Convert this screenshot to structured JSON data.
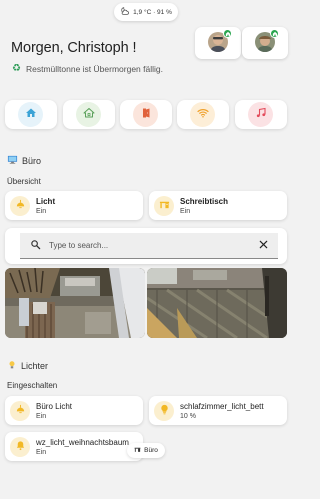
{
  "header": {
    "weather_text": "1,9 °C · 91 %",
    "weather_icon": "partly-cloudy-night-icon",
    "greeting": "Morgen, Christoph !",
    "notice": "Restmülltonne ist Übermorgen fällig.",
    "notice_icon": "recycle-icon"
  },
  "persons": [
    {
      "icon": "avatar",
      "status": "home"
    },
    {
      "icon": "avatar",
      "status": "home"
    }
  ],
  "nav": [
    {
      "icon": "home-icon",
      "color": "#3ba3d6",
      "bg": "#e6f3fa"
    },
    {
      "icon": "house-outline-icon",
      "color": "#5aa05a",
      "bg": "#e8f3e4"
    },
    {
      "icon": "door-icon",
      "color": "#e0623c",
      "bg": "#fbe5dc"
    },
    {
      "icon": "wifi-icon",
      "color": "#f0a12c",
      "bg": "#fdeed7"
    },
    {
      "icon": "music-icon",
      "color": "#e34a5a",
      "bg": "#fbe2e4"
    }
  ],
  "colors": {
    "accent_yellow": "#f2b824",
    "tile_icon_bg": "#fbefcf"
  },
  "buero": {
    "title": "Büro",
    "overview_title": "Übersicht",
    "tiles": [
      {
        "name": "Licht",
        "state": "Ein",
        "icon": "ceiling-light-icon"
      },
      {
        "name": "Schreibtisch",
        "state": "Ein",
        "icon": "desk-icon"
      }
    ],
    "search": {
      "placeholder": "Type to search...",
      "value": ""
    }
  },
  "lights": {
    "title": "Lichter",
    "subtitle": "Eingeschalten",
    "tiles": [
      {
        "name": "Büro Licht",
        "state": "Ein",
        "icon": "ceiling-light-icon"
      },
      {
        "name": "schlafzimmer_licht_bett",
        "state": "10 %",
        "icon": "bulb-icon"
      },
      {
        "name": "wz_licht_weihnachtsbaum",
        "state": "Ein",
        "icon": "bell-icon"
      }
    ]
  },
  "footer": {
    "label": "Büro",
    "icon": "desk-icon"
  }
}
